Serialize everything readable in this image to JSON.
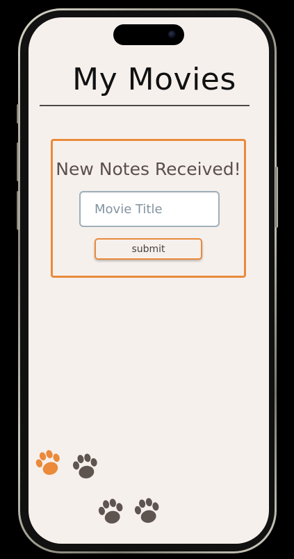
{
  "header": {
    "title": "My Movies"
  },
  "notes_card": {
    "heading": "New Notes Received!",
    "movie_title_placeholder": "Movie Title",
    "movie_title_value": "",
    "submit_label": "submit"
  },
  "decorations": {
    "paw_icons": [
      "paw-icon-orange",
      "paw-icon-brown",
      "paw-icon-brown",
      "paw-icon-brown"
    ]
  },
  "colors": {
    "accent": "#ea8a3a",
    "paw_brown": "#5e5450",
    "background": "#f6f0ed",
    "title_text": "#111111",
    "heading_text": "#5a4f4b"
  }
}
